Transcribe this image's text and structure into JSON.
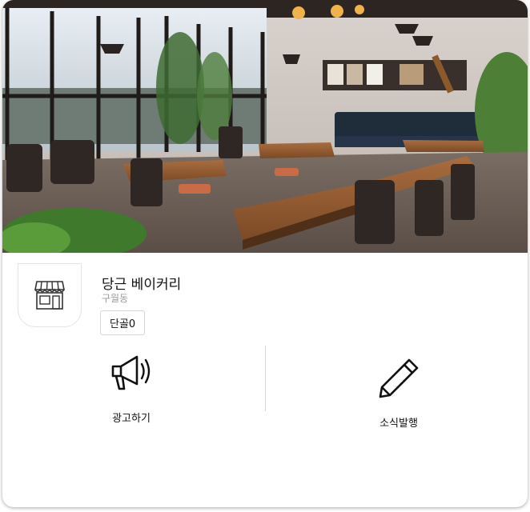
{
  "shop": {
    "name": "당근 베이커리",
    "region": "구월동",
    "regulars_label": "단골0"
  },
  "actions": {
    "advertise": {
      "label": "광고하기",
      "icon": "megaphone-icon"
    },
    "post_news": {
      "label": "소식발행",
      "icon": "pencil-icon"
    }
  },
  "icons": {
    "profile": "storefront-icon"
  },
  "colors": {
    "text": "#111111",
    "subtext": "#9a9a9a",
    "border": "#d6d6d6"
  }
}
